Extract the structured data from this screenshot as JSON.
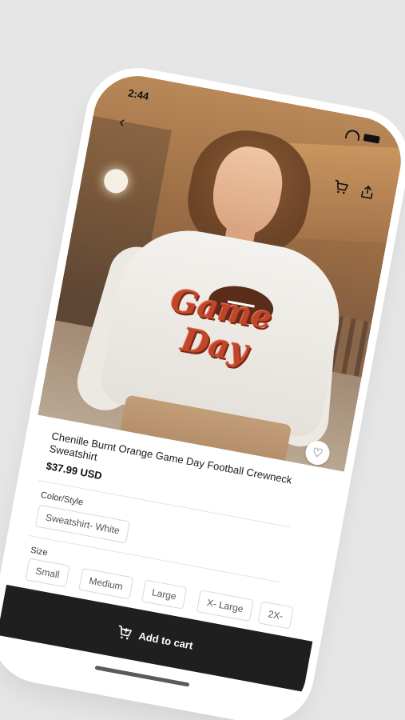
{
  "status_bar": {
    "time": "2:44"
  },
  "icons": {
    "back": "chevron-left",
    "cart": "cart",
    "share": "share",
    "favorite": "heart",
    "add_to_cart": "cart-plus"
  },
  "product": {
    "title": "Chenille Burnt Orange Game Day Football Crewneck Sweatshirt",
    "price": "$37.99 USD",
    "graphic_line1": "Game",
    "graphic_line2": "Day"
  },
  "options": {
    "color_label": "Color/Style",
    "color_selected": "Sweatshirt- White",
    "size_label": "Size",
    "sizes": [
      "Small",
      "Medium",
      "Large",
      "X- Large",
      "2X-"
    ]
  },
  "cta": {
    "add_to_cart_label": "Add to cart"
  }
}
